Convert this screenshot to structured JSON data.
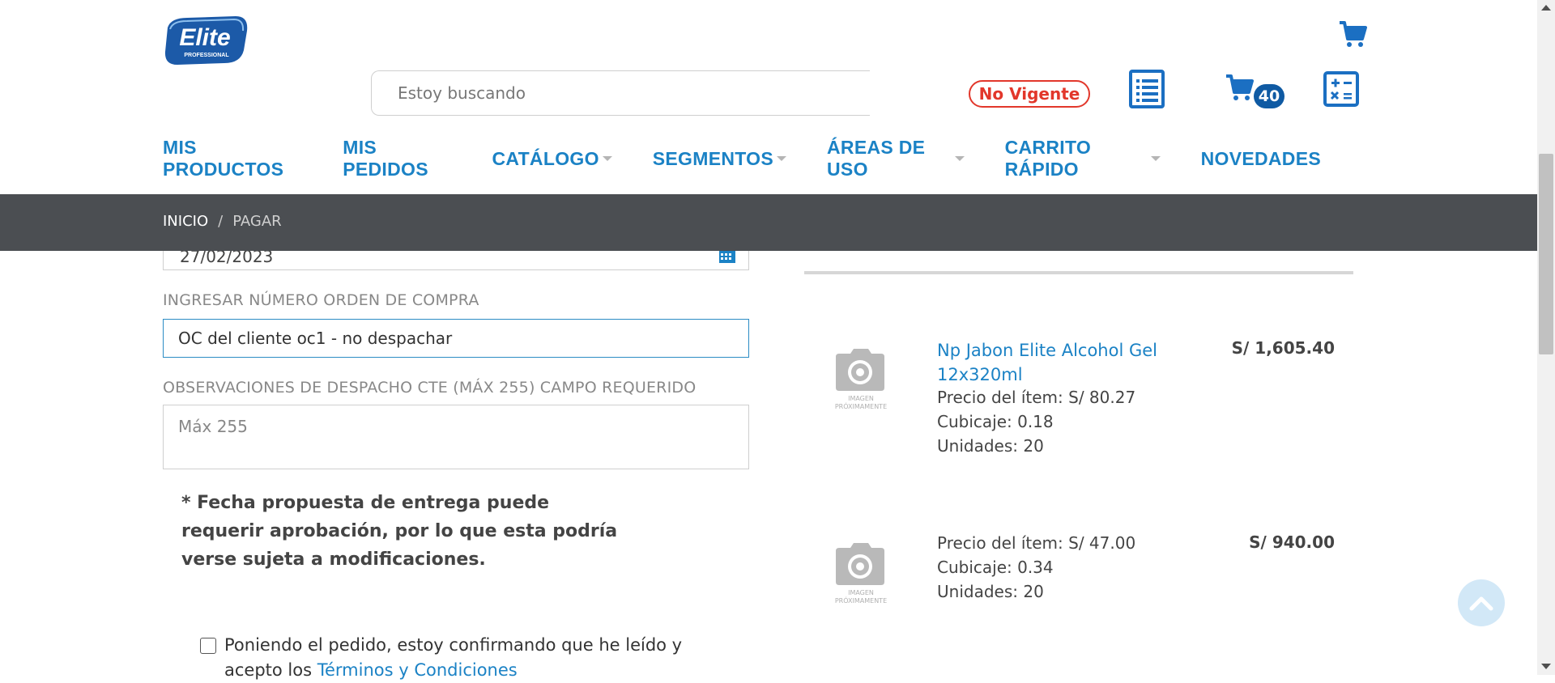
{
  "brand": {
    "logo_text": "Elite",
    "logo_subtext": "PROFESSIONAL"
  },
  "header": {
    "search_placeholder": "Estoy buscando",
    "status_badge": "No Vigente",
    "cart_count": "40",
    "icons": [
      "cart-icon",
      "order-list-icon",
      "calculator-icon"
    ]
  },
  "nav": {
    "items": [
      {
        "label": "MIS PRODUCTOS",
        "dropdown": false
      },
      {
        "label": "MIS PEDIDOS",
        "dropdown": false
      },
      {
        "label": "CATÁLOGO",
        "dropdown": true
      },
      {
        "label": "SEGMENTOS",
        "dropdown": true
      },
      {
        "label": "ÁREAS DE USO",
        "dropdown": true
      },
      {
        "label": "CARRITO RÁPIDO",
        "dropdown": true
      },
      {
        "label": "NOVEDADES",
        "dropdown": false
      }
    ]
  },
  "breadcrumb": {
    "home": "INICIO",
    "separator": "/",
    "current": "PAGAR"
  },
  "form": {
    "date_value": "27/02/2023",
    "oc_label": "INGRESAR NÚMERO ORDEN DE COMPRA",
    "oc_value": "OC del cliente oc1 - no despachar",
    "obs_label": "OBSERVACIONES DE DESPACHO CTE (MÁX 255) CAMPO REQUERIDO",
    "obs_placeholder": "Máx 255",
    "note": "* Fecha propuesta de entrega puede requerir aprobación, por lo que esta podría verse sujeta a modificaciones.",
    "terms_text": "Poniendo el pedido, estoy confirmando que he leído y acepto los",
    "terms_link": "Términos y Condiciones"
  },
  "order": {
    "image_caption_1": "IMAGEN",
    "image_caption_2": "PRÓXIMAMENTE",
    "items": [
      {
        "title": "Np Jabon Elite Alcohol Gel 12x320ml",
        "unit_price": "Precio del ítem:  S/ 80.27",
        "cubicaje": "Cubicaje: 0.18",
        "unidades": "Unidades: 20",
        "total": "S/ 1,605.40"
      },
      {
        "title": "",
        "unit_price": "Precio del ítem:  S/ 47.00",
        "cubicaje": "Cubicaje: 0.34",
        "unidades": "Unidades: 20",
        "total": "S/ 940.00"
      }
    ]
  },
  "colors": {
    "brand_blue": "#1b82c5",
    "dark_blue": "#0f5aa3",
    "alert_red": "#e2372b",
    "breadcrumb_bg": "#4b4e52"
  }
}
